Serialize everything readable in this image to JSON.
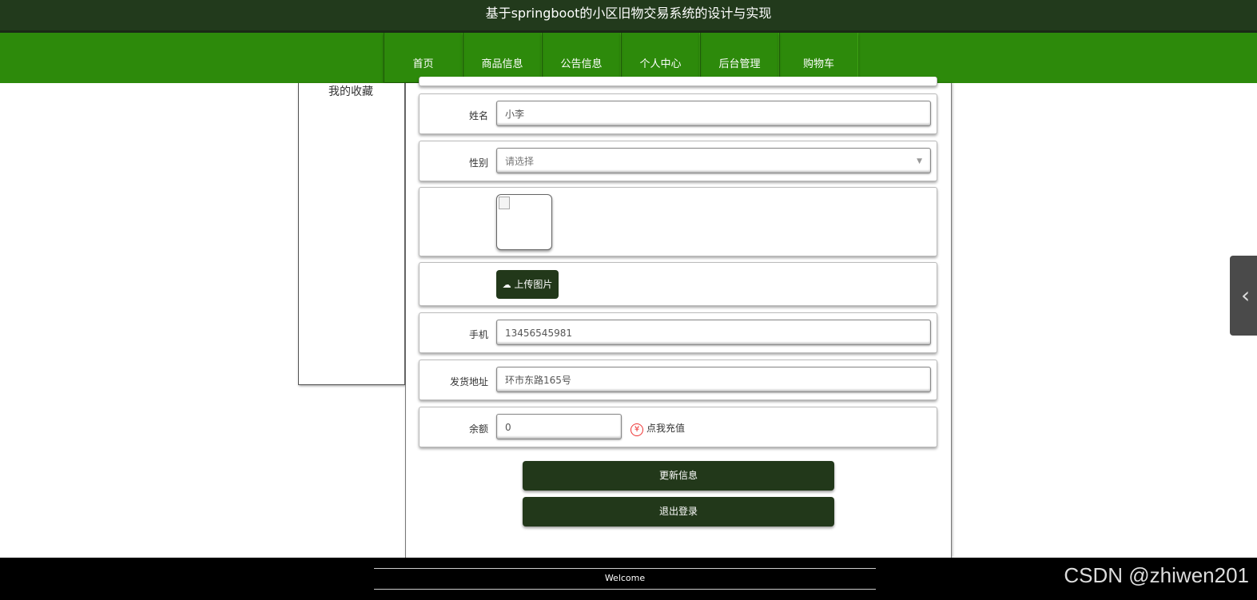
{
  "app": {
    "title": "基于springboot的小区旧物交易系统的设计与实现"
  },
  "nav": {
    "items": [
      "首页",
      "商品信息",
      "公告信息",
      "个人中心",
      "后台管理",
      "购物车"
    ]
  },
  "sidebar": {
    "item": "我的收藏"
  },
  "form": {
    "name": {
      "label": "姓名",
      "value": "小李"
    },
    "gender": {
      "label": "性别",
      "placeholder": "请选择"
    },
    "upload": {
      "label": "上传图片"
    },
    "phone": {
      "label": "手机",
      "value": "13456545981"
    },
    "address": {
      "label": "发货地址",
      "value": "环市东路165号"
    },
    "balance": {
      "label": "余额",
      "value": "0",
      "recharge": "点我充值"
    }
  },
  "buttons": {
    "update": "更新信息",
    "logout": "退出登录"
  },
  "footer": {
    "welcome": "Welcome"
  },
  "watermark": "CSDN @zhiwen201",
  "colors": {
    "header": "#223a1c",
    "nav": "#2d8a0b",
    "button": "#22381a"
  }
}
